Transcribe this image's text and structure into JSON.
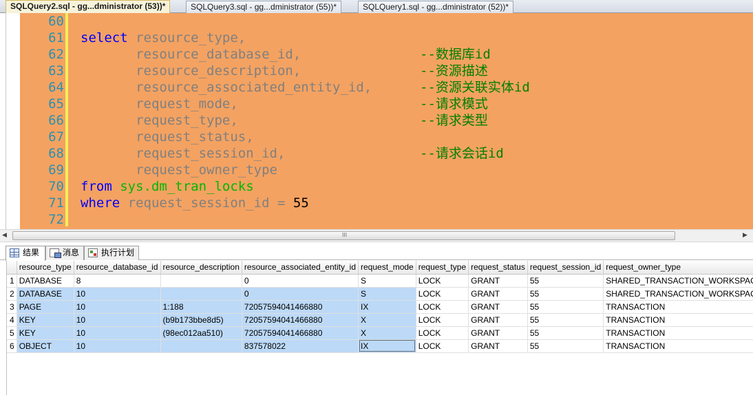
{
  "tabs": [
    {
      "label": "SQLQuery2.sql - gg...dministrator (53))*",
      "active": true
    },
    {
      "label": "SQLQuery3.sql - gg...dministrator (55))*",
      "active": false
    },
    {
      "label": "SQLQuery1.sql - gg...dministrator (52))*",
      "active": false
    }
  ],
  "editor": {
    "lines": [
      {
        "num": "60",
        "code": [],
        "comment": ""
      },
      {
        "num": "61",
        "code": [
          {
            "t": "select",
            "c": "kw"
          },
          {
            "t": " resource_type,",
            "c": "ident"
          }
        ],
        "comment": ""
      },
      {
        "num": "62",
        "code": [
          {
            "t": "       resource_database_id,",
            "c": "ident"
          }
        ],
        "comment": "--数据库id"
      },
      {
        "num": "63",
        "code": [
          {
            "t": "       resource_description,",
            "c": "ident"
          }
        ],
        "comment": "--资源描述"
      },
      {
        "num": "64",
        "code": [
          {
            "t": "       resource_associated_entity_id,",
            "c": "ident"
          }
        ],
        "comment": "--资源关联实体id"
      },
      {
        "num": "65",
        "code": [
          {
            "t": "       request_mode,",
            "c": "ident"
          }
        ],
        "comment": "--请求模式"
      },
      {
        "num": "66",
        "code": [
          {
            "t": "       request_type,",
            "c": "ident"
          }
        ],
        "comment": "--请求类型"
      },
      {
        "num": "67",
        "code": [
          {
            "t": "       request_status,",
            "c": "ident"
          }
        ],
        "comment": ""
      },
      {
        "num": "68",
        "code": [
          {
            "t": "       request_session_id,",
            "c": "ident"
          }
        ],
        "comment": "--请求会话id"
      },
      {
        "num": "69",
        "code": [
          {
            "t": "       request_owner_type",
            "c": "ident"
          }
        ],
        "comment": ""
      },
      {
        "num": "70",
        "code": [
          {
            "t": "from",
            "c": "kw"
          },
          {
            "t": " ",
            "c": "ident"
          },
          {
            "t": "sys.dm_tran_locks",
            "c": "sys"
          }
        ],
        "comment": ""
      },
      {
        "num": "71",
        "code": [
          {
            "t": "where",
            "c": "kw"
          },
          {
            "t": " request_session_id = ",
            "c": "ident"
          },
          {
            "t": "55",
            "c": "num"
          }
        ],
        "comment": ""
      },
      {
        "num": "72",
        "code": [],
        "comment": ""
      }
    ]
  },
  "scrollbar": {
    "grip": "III"
  },
  "result_tabs": [
    {
      "label": "结果",
      "icon": "grid-icon",
      "active": true
    },
    {
      "label": "消息",
      "icon": "message-icon",
      "active": false
    },
    {
      "label": "执行计划",
      "icon": "execution-plan-icon",
      "active": false
    }
  ],
  "grid": {
    "columns": [
      "resource_type",
      "resource_database_id",
      "resource_description",
      "resource_associated_entity_id",
      "request_mode",
      "request_type",
      "request_status",
      "request_session_id",
      "request_owner_type"
    ],
    "rows": [
      [
        "1",
        "DATABASE",
        "8",
        "",
        "0",
        "S",
        "LOCK",
        "GRANT",
        "55",
        "SHARED_TRANSACTION_WORKSPACE"
      ],
      [
        "2",
        "DATABASE",
        "10",
        "",
        "0",
        "S",
        "LOCK",
        "GRANT",
        "55",
        "SHARED_TRANSACTION_WORKSPACE"
      ],
      [
        "3",
        "PAGE",
        "10",
        "1:188",
        "72057594041466880",
        "IX",
        "LOCK",
        "GRANT",
        "55",
        "TRANSACTION"
      ],
      [
        "4",
        "KEY",
        "10",
        "(b9b173bbe8d5)",
        "72057594041466880",
        "X",
        "LOCK",
        "GRANT",
        "55",
        "TRANSACTION"
      ],
      [
        "5",
        "KEY",
        "10",
        "(98ec012aa510)",
        "72057594041466880",
        "X",
        "LOCK",
        "GRANT",
        "55",
        "TRANSACTION"
      ],
      [
        "6",
        "OBJECT",
        "10",
        "",
        "837578022",
        "IX",
        "LOCK",
        "GRANT",
        "55",
        "TRANSACTION"
      ]
    ]
  }
}
